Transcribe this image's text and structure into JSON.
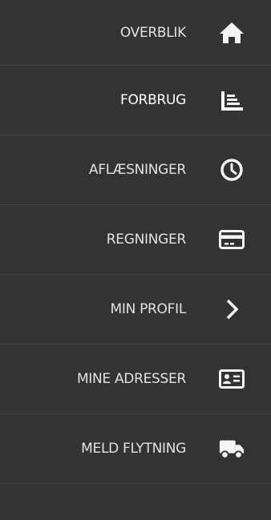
{
  "menu": {
    "items": [
      {
        "label": "OVERBLIK",
        "icon": "home-icon"
      },
      {
        "label": "FORBRUG",
        "icon": "bar-chart-icon",
        "active": true
      },
      {
        "label": "AFLÆSNINGER",
        "icon": "clock-icon"
      },
      {
        "label": "REGNINGER",
        "icon": "credit-card-icon"
      },
      {
        "label": "MIN PROFIL",
        "icon": "chevron-right-icon"
      },
      {
        "label": "MINE ADRESSER",
        "icon": "id-card-icon"
      },
      {
        "label": "MELD FLYTNING",
        "icon": "truck-icon"
      }
    ]
  },
  "colors": {
    "background": "#333333",
    "text": "#e2e2e2",
    "active_text": "#ffffff",
    "icon": "#f5f5f5"
  }
}
